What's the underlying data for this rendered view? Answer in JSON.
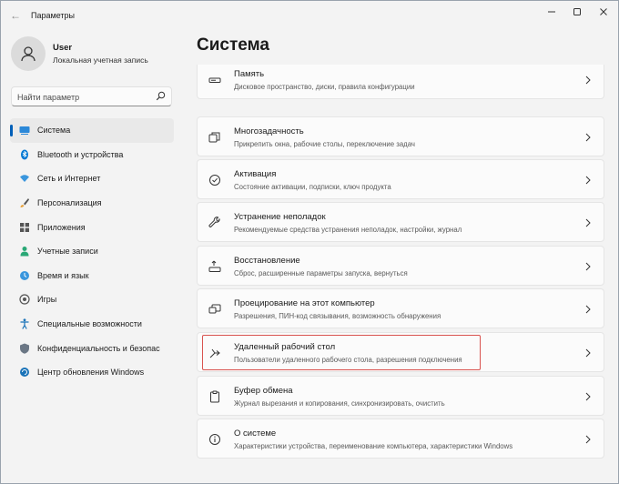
{
  "window": {
    "title": "Параметры"
  },
  "profile": {
    "name": "User",
    "account_type": "Локальная учетная запись"
  },
  "search": {
    "placeholder": "Найти параметр"
  },
  "sidebar": {
    "items": [
      {
        "label": "Система",
        "icon": "monitor-icon",
        "active": true
      },
      {
        "label": "Bluetooth и устройства",
        "icon": "bluetooth-icon"
      },
      {
        "label": "Сеть и Интернет",
        "icon": "wifi-icon"
      },
      {
        "label": "Персонализация",
        "icon": "brush-icon"
      },
      {
        "label": "Приложения",
        "icon": "apps-icon"
      },
      {
        "label": "Учетные записи",
        "icon": "person-icon"
      },
      {
        "label": "Время и язык",
        "icon": "globe-clock-icon"
      },
      {
        "label": "Игры",
        "icon": "gamepad-icon"
      },
      {
        "label": "Специальные возможности",
        "icon": "accessibility-icon"
      },
      {
        "label": "Конфиденциальность и безопасность",
        "icon": "shield-icon"
      },
      {
        "label": "Центр обновления Windows",
        "icon": "update-icon"
      }
    ]
  },
  "main": {
    "title": "Система",
    "cards": [
      {
        "title": "Память",
        "desc": "Дисковое пространство, диски, правила конфигурации",
        "icon": "storage-icon"
      },
      {
        "title": "Многозадачность",
        "desc": "Прикрепить окна, рабочие столы, переключение задач",
        "icon": "multitasking-icon"
      },
      {
        "title": "Активация",
        "desc": "Состояние активации, подписки, ключ продукта",
        "icon": "check-circle-icon"
      },
      {
        "title": "Устранение неполадок",
        "desc": "Рекомендуемые средства устранения неполадок, настройки, журнал",
        "icon": "wrench-icon"
      },
      {
        "title": "Восстановление",
        "desc": "Сброс, расширенные параметры запуска, вернуться",
        "icon": "recovery-icon"
      },
      {
        "title": "Проецирование на этот компьютер",
        "desc": "Разрешения, ПИН-код связывания, возможность обнаружения",
        "icon": "projection-icon"
      },
      {
        "title": "Удаленный рабочий стол",
        "desc": "Пользователи удаленного рабочего стола, разрешения подключения",
        "icon": "remote-desktop-icon",
        "highlighted": true
      },
      {
        "title": "Буфер обмена",
        "desc": "Журнал вырезания и копирования, синхронизировать, очистить",
        "icon": "clipboard-icon"
      },
      {
        "title": "О системе",
        "desc": "Характеристики устройства, переименование компьютера, характеристики Windows",
        "icon": "info-icon"
      }
    ]
  },
  "colors": {
    "accent": "#005fb8",
    "highlight_border": "#d9534f",
    "window_bg": "#f3f3f3",
    "card_bg": "#fbfbfb"
  }
}
